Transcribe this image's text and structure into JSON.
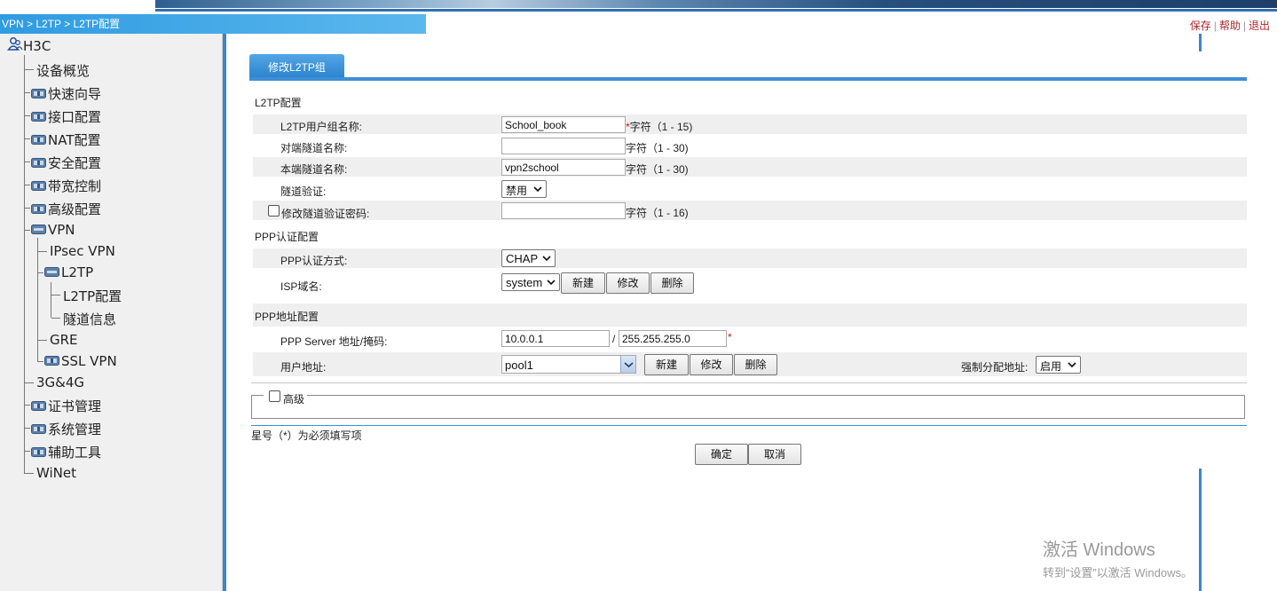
{
  "breadcrumb": {
    "path": "VPN > L2TP > L2TP配置"
  },
  "toplinks": {
    "save": "保存",
    "help": "帮助",
    "logout": "退出"
  },
  "sidebar": {
    "root": "H3C",
    "items": [
      {
        "label": "设备概览"
      },
      {
        "label": "快速向导"
      },
      {
        "label": "接口配置"
      },
      {
        "label": "NAT配置"
      },
      {
        "label": "安全配置"
      },
      {
        "label": "带宽控制"
      },
      {
        "label": "高级配置"
      },
      {
        "label": "VPN"
      },
      {
        "label": "IPsec VPN"
      },
      {
        "label": "L2TP"
      },
      {
        "label": "L2TP配置"
      },
      {
        "label": "隧道信息"
      },
      {
        "label": "GRE"
      },
      {
        "label": "SSL VPN"
      },
      {
        "label": "3G&4G"
      },
      {
        "label": "证书管理"
      },
      {
        "label": "系统管理"
      },
      {
        "label": "辅助工具"
      },
      {
        "label": "WiNet"
      }
    ]
  },
  "tab": {
    "label": "修改L2TP组"
  },
  "l2tp": {
    "section": "L2TP配置",
    "group_name_label": "L2TP用户组名称:",
    "group_name_value": "School_book",
    "group_name_hint": "字符（1 - 15)",
    "peer_tunnel_label": "对端隧道名称:",
    "peer_tunnel_value": "",
    "peer_tunnel_hint": "字符（1 - 30)",
    "local_tunnel_label": "本端隧道名称:",
    "local_tunnel_value": "vpn2school",
    "local_tunnel_hint": "字符（1 - 30)",
    "tunnel_auth_label": "隧道验证:",
    "tunnel_auth_value": "禁用",
    "change_pwd_label": "修改隧道验证密码:",
    "change_pwd_value": "",
    "change_pwd_hint": "字符（1 - 16)",
    "required_mark": "*"
  },
  "ppp_auth": {
    "section": "PPP认证配置",
    "method_label": "PPP认证方式:",
    "method_value": "CHAP",
    "isp_label": "ISP域名:",
    "isp_value": "system",
    "new_label": "新建",
    "modify_label": "修改",
    "delete_label": "删除"
  },
  "ppp_addr": {
    "section": "PPP地址配置",
    "server_label": "PPP Server 地址/掩码:",
    "server_ip": "10.0.0.1",
    "slash": "/",
    "server_mask": "255.255.255.0",
    "user_addr_label": "用户地址:",
    "user_addr_value": "pool1",
    "new_label": "新建",
    "modify_label": "修改",
    "delete_label": "删除",
    "force_label": "强制分配地址:",
    "force_value": "启用"
  },
  "advanced": {
    "label": "高级"
  },
  "note": "星号（*）为必须填写项",
  "actions": {
    "ok": "确定",
    "cancel": "取消"
  },
  "watermark": {
    "line1": "激活 Windows",
    "line2": "转到“设置”以激活 Windows。"
  },
  "colors": {
    "accent": "#3e8ed8",
    "crumb": "#2f9be0",
    "link": "#b0282e",
    "required": "#d01818"
  }
}
